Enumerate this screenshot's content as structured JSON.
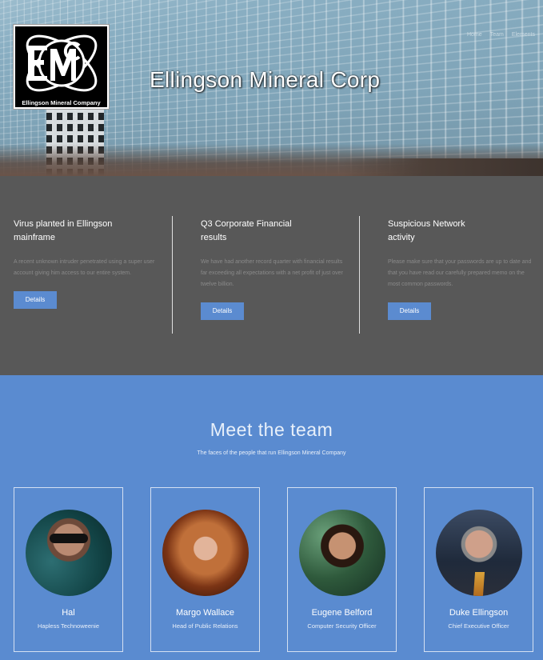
{
  "header": {
    "logo_initials": "EMC",
    "logo_caption": "Ellingson Mineral Company",
    "title": "Ellingson Mineral Corp",
    "nav": [
      "Home",
      "Team",
      "Elements"
    ]
  },
  "news": [
    {
      "title": "Virus planted in Ellingson mainframe",
      "body": "A recent unknown intruder penetrated using a super user account giving him access to our entire system.",
      "button": "Details"
    },
    {
      "title": "Q3 Corporate Financial results",
      "body": "We have had another record quarter with financial results far exceeding all expectations with a net profit of just over twelve billion.",
      "button": "Details"
    },
    {
      "title": "Suspicious Network activity",
      "body": "Please make sure that your passwords are up to date and that you have read our carefully prepared memo on the most common passwords.",
      "button": "Details"
    }
  ],
  "team": {
    "title": "Meet the team",
    "subtitle": "The faces of the people that run Ellingson Mineral Company",
    "members": [
      {
        "name": "Hal",
        "role": "Hapless Technoweenie"
      },
      {
        "name": "Margo Wallace",
        "role": "Head of Public Relations"
      },
      {
        "name": "Eugene Belford",
        "role": "Computer Security Officer"
      },
      {
        "name": "Duke Ellingson",
        "role": "Chief Executive Officer"
      }
    ]
  },
  "colors": {
    "accent_blue": "#5a8bd0",
    "dark_gray": "#585858",
    "button": "#5b8bd0"
  }
}
